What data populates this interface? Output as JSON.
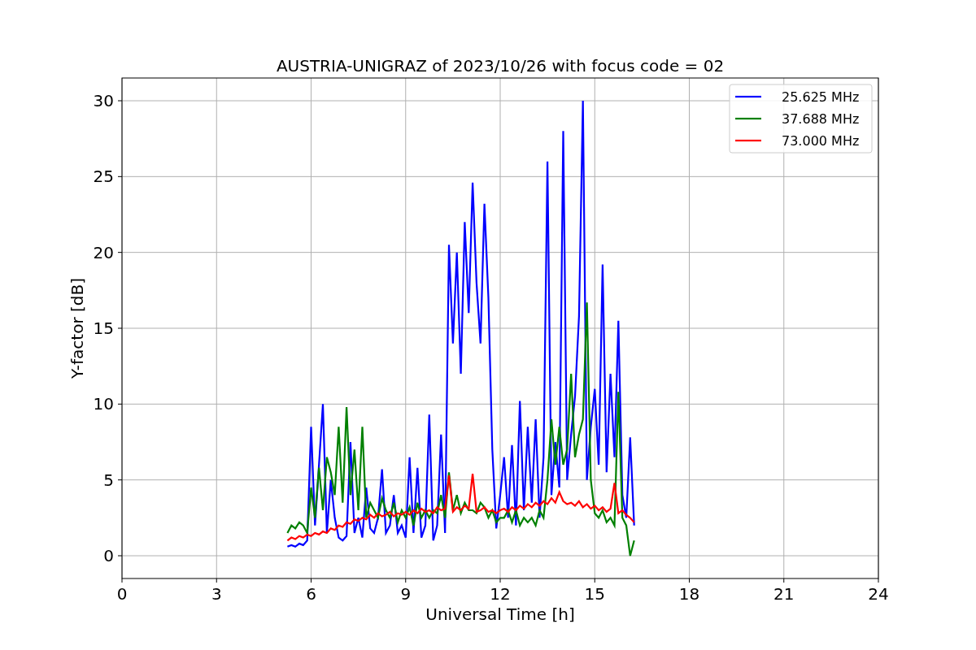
{
  "chart_data": {
    "type": "line",
    "title": "AUSTRIA-UNIGRAZ of 2023/10/26 with focus code = 02",
    "xlabel": "Universal Time [h]",
    "ylabel": "Y-factor [dB]",
    "x": [
      5.25,
      5.375,
      5.5,
      5.625,
      5.75,
      5.875,
      6,
      6.125,
      6.25,
      6.375,
      6.5,
      6.625,
      6.75,
      6.875,
      7,
      7.125,
      7.25,
      7.375,
      7.5,
      7.625,
      7.75,
      7.875,
      8,
      8.125,
      8.25,
      8.375,
      8.5,
      8.625,
      8.75,
      8.875,
      9,
      9.125,
      9.25,
      9.375,
      9.5,
      9.625,
      9.75,
      9.875,
      10,
      10.125,
      10.25,
      10.375,
      10.5,
      10.625,
      10.75,
      10.875,
      11,
      11.125,
      11.25,
      11.375,
      11.5,
      11.625,
      11.75,
      11.875,
      12,
      12.125,
      12.25,
      12.375,
      12.5,
      12.625,
      12.75,
      12.875,
      13,
      13.125,
      13.25,
      13.375,
      13.5,
      13.625,
      13.75,
      13.875,
      14,
      14.125,
      14.25,
      14.375,
      14.5,
      14.625,
      14.75,
      14.875,
      15,
      15.125,
      15.25,
      15.375,
      15.5,
      15.625,
      15.75,
      15.875,
      16,
      16.125,
      16.25
    ],
    "series": [
      {
        "name": "25.625 MHz",
        "color": "#0000ff",
        "values": [
          0.6,
          0.7,
          0.6,
          0.8,
          0.7,
          1.0,
          8.5,
          2.0,
          6.0,
          10.0,
          1.5,
          5.0,
          2.5,
          1.2,
          1.0,
          1.3,
          7.5,
          1.5,
          2.5,
          1.2,
          4.5,
          1.8,
          1.5,
          2.5,
          5.7,
          1.5,
          2.0,
          4.0,
          1.5,
          2.0,
          1.2,
          6.5,
          1.5,
          5.8,
          1.2,
          2.0,
          9.3,
          1.0,
          2.0,
          8.0,
          1.5,
          20.5,
          14.0,
          20.0,
          12.0,
          22.0,
          16.0,
          24.6,
          18.0,
          14.0,
          23.2,
          17.0,
          7.0,
          1.8,
          4.0,
          6.5,
          2.5,
          7.3,
          2.0,
          10.2,
          3.0,
          8.5,
          3.5,
          9.0,
          2.5,
          6.5,
          26.0,
          4.0,
          7.5,
          4.5,
          28.0,
          5.0,
          8.0,
          10.5,
          15.8,
          30.0,
          5.0,
          8.5,
          11.0,
          6.0,
          19.2,
          5.5,
          12.0,
          6.5,
          15.5,
          4.0,
          2.5,
          7.8,
          2.0
        ]
      },
      {
        "name": "37.688 MHz",
        "color": "#008000",
        "values": [
          1.5,
          2.0,
          1.8,
          2.2,
          2.0,
          1.5,
          4.5,
          2.5,
          5.8,
          3.0,
          6.5,
          5.5,
          4.0,
          8.5,
          3.5,
          9.8,
          4.0,
          7.0,
          3.0,
          8.5,
          2.5,
          3.5,
          3.0,
          2.5,
          3.8,
          3.0,
          2.5,
          3.5,
          2.2,
          3.0,
          2.5,
          3.2,
          2.0,
          3.5,
          2.5,
          3.0,
          2.5,
          3.0,
          2.8,
          4.0,
          2.5,
          5.5,
          3.0,
          4.0,
          2.8,
          3.5,
          3.0,
          3.0,
          2.8,
          3.5,
          3.2,
          2.5,
          3.0,
          2.2,
          2.5,
          2.5,
          3.0,
          2.2,
          3.0,
          2.0,
          2.5,
          2.2,
          2.5,
          2.0,
          3.0,
          2.5,
          5.0,
          9.0,
          6.0,
          8.5,
          6.0,
          7.0,
          12.0,
          6.5,
          8.0,
          9.0,
          16.7,
          5.0,
          2.8,
          2.5,
          3.0,
          2.2,
          2.5,
          2.0,
          10.8,
          2.5,
          2.0,
          0.0,
          1.0
        ]
      },
      {
        "name": "73.000 MHz",
        "color": "#ff0000",
        "values": [
          1.0,
          1.2,
          1.1,
          1.3,
          1.2,
          1.4,
          1.3,
          1.5,
          1.4,
          1.6,
          1.5,
          1.8,
          1.7,
          2.0,
          1.9,
          2.2,
          2.1,
          2.4,
          2.3,
          2.5,
          2.4,
          2.7,
          2.5,
          2.8,
          2.6,
          2.7,
          2.9,
          2.6,
          2.8,
          2.7,
          2.9,
          2.7,
          3.0,
          2.8,
          3.1,
          2.9,
          3.0,
          2.8,
          3.2,
          3.0,
          3.1,
          5.3,
          2.9,
          3.2,
          3.0,
          3.3,
          3.1,
          5.4,
          2.9,
          3.0,
          3.2,
          2.9,
          3.0,
          2.8,
          3.0,
          3.1,
          2.9,
          3.2,
          3.0,
          3.3,
          3.1,
          3.4,
          3.2,
          3.5,
          3.3,
          3.6,
          3.4,
          3.8,
          3.5,
          4.2,
          3.6,
          3.4,
          3.5,
          3.3,
          3.6,
          3.2,
          3.4,
          3.1,
          3.3,
          3.0,
          3.2,
          2.9,
          3.1,
          4.8,
          2.8,
          3.0,
          2.7,
          2.5,
          2.2
        ]
      }
    ],
    "grid": true,
    "legend": "upper right",
    "xlim": [
      0,
      24
    ],
    "ylim": [
      -1.5,
      31.5
    ],
    "xticks": [
      0,
      3,
      6,
      9,
      12,
      15,
      18,
      21,
      24
    ],
    "yticks": [
      0,
      5,
      10,
      15,
      20,
      25,
      30
    ]
  }
}
